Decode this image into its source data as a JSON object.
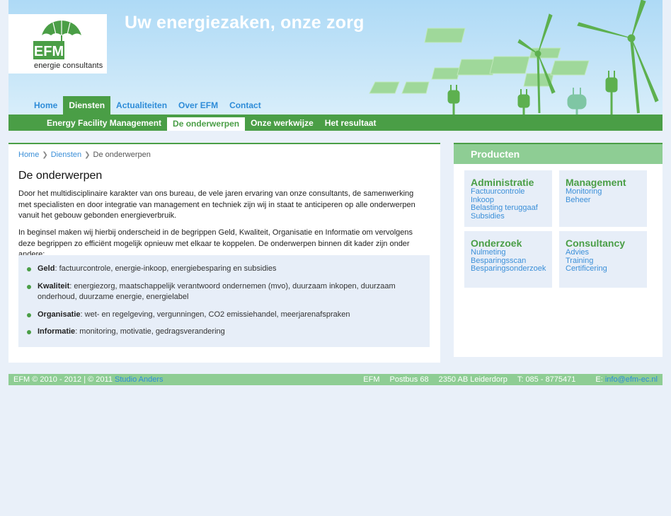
{
  "header": {
    "logo_text": "EFM",
    "logo_subtitle": "energie consultants",
    "tagline": "Uw energiezaken, onze zorg"
  },
  "main_nav": [
    {
      "label": "Home",
      "active": false
    },
    {
      "label": "Diensten",
      "active": true
    },
    {
      "label": "Actualiteiten",
      "active": false
    },
    {
      "label": "Over EFM",
      "active": false
    },
    {
      "label": "Contact",
      "active": false
    }
  ],
  "sub_nav": [
    {
      "label": "Energy Facility Management",
      "active": false
    },
    {
      "label": "De onderwerpen",
      "active": true
    },
    {
      "label": "Onze werkwijze",
      "active": false
    },
    {
      "label": "Het resultaat",
      "active": false
    }
  ],
  "breadcrumb": {
    "home": "Home",
    "diensten": "Diensten",
    "current": "De onderwerpen"
  },
  "content": {
    "title": "De onderwerpen",
    "paragraph1": "Door het multidisciplinaire karakter van ons bureau, de vele jaren ervaring van onze consultants, de samenwerking met specialisten en door integratie van management en techniek zijn wij in staat te anticiperen op alle onderwerpen vanuit het gebouw gebonden energieverbruik.",
    "paragraph2": "In beginsel maken wij hierbij onderscheid in de begrippen Geld, Kwaliteit, Organisatie en Informatie om vervolgens deze begrippen zo efficiënt mogelijk opnieuw met elkaar te koppelen. De onderwerpen binnen dit kader zijn onder andere:",
    "topics": [
      {
        "term": "Geld",
        "text": ": factuurcontrole, energie-inkoop, energiebesparing en subsidies"
      },
      {
        "term": "Kwaliteit",
        "text": ": energiezorg, maatschappelijk verantwoord ondernemen (mvo), duurzaam inkopen, duurzaam onderhoud, duurzame energie, energielabel"
      },
      {
        "term": "Organisatie",
        "text": ": wet- en regelgeving, vergunningen, CO2 emissiehandel, meerjarenafspraken"
      },
      {
        "term": "Informatie",
        "text": ": monitoring, motivatie, gedragsverandering"
      }
    ]
  },
  "sidebar": {
    "title": "Producten",
    "groups": [
      {
        "title": "Administratie",
        "links": [
          "Factuurcontrole",
          "Inkoop",
          "Belasting teruggaaf",
          "Subsidies"
        ]
      },
      {
        "title": "Management",
        "links": [
          "Monitoring",
          "Beheer"
        ]
      },
      {
        "title": "Onderzoek",
        "links": [
          "Nulmeting",
          "Besparingsscan",
          "Besparingsonderzoek"
        ]
      },
      {
        "title": "Consultancy",
        "links": [
          "Advies",
          "Training",
          "Certificering"
        ]
      }
    ]
  },
  "footer": {
    "copyright": "EFM © 2010 - 2012 | © 2011 ",
    "credit_link": "Studio Anders",
    "company": "EFM",
    "address1": "Postbus 68",
    "address2": "2350 AB Leiderdorp",
    "phone": "T: 085 - 8775471",
    "email_label": "E: ",
    "email": "info@efm-ec.nl"
  },
  "colors": {
    "green": "#4a9e46",
    "light_green": "#8ecd94",
    "link_blue": "#3b8fd8",
    "panel_bg": "#e7eef8"
  }
}
